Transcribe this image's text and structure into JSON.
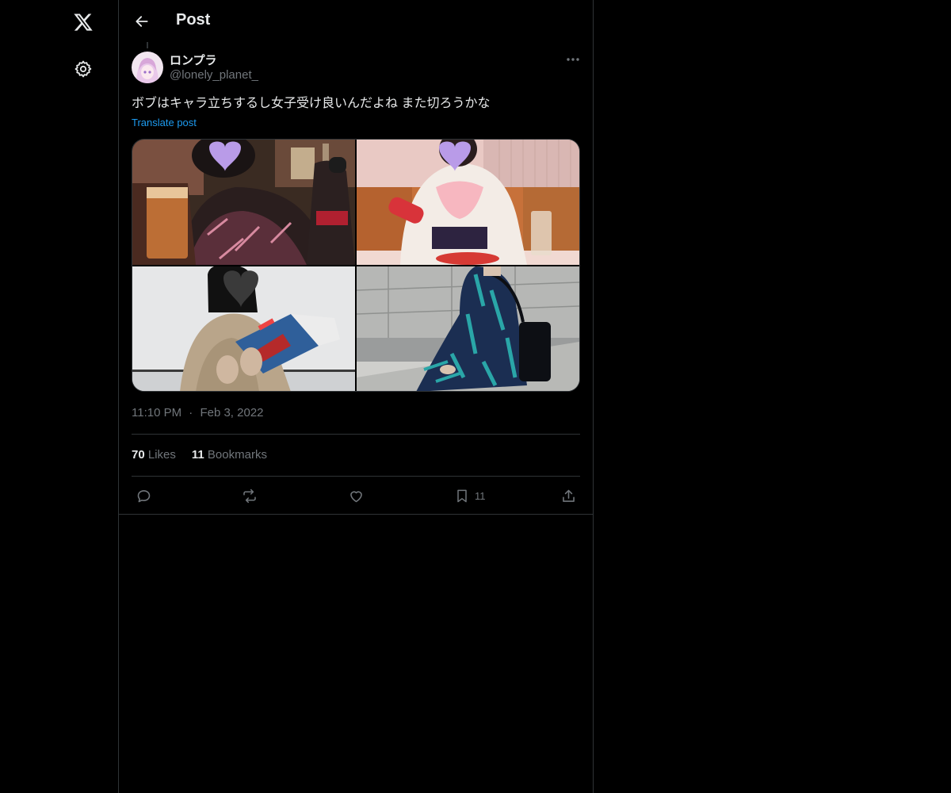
{
  "header": {
    "title": "Post"
  },
  "post": {
    "author": {
      "name": "ロンプラ",
      "handle": "@lonely_planet_"
    },
    "text": "ボブはキャラ立ちするし女子受け良いんだよね また切ろうかな",
    "translate_label": "Translate post",
    "time": "11:10 PM",
    "separator": "·",
    "date": "Feb 3, 2022",
    "stats": {
      "likes_count": "70",
      "likes_label": "Likes",
      "bookmarks_count": "11",
      "bookmarks_label": "Bookmarks"
    },
    "actions": {
      "bookmark_count": "11"
    },
    "media": [
      {
        "icon": "photo-bar-drink"
      },
      {
        "icon": "photo-cafe-white-blouse"
      },
      {
        "icon": "photo-reading-magazine"
      },
      {
        "icon": "photo-sitting-blue-dress"
      }
    ]
  },
  "colors": {
    "background": "#000000",
    "border": "#2f3336",
    "accent": "#1d9bf0",
    "muted": "#71767b",
    "text": "#e7e9ea"
  }
}
